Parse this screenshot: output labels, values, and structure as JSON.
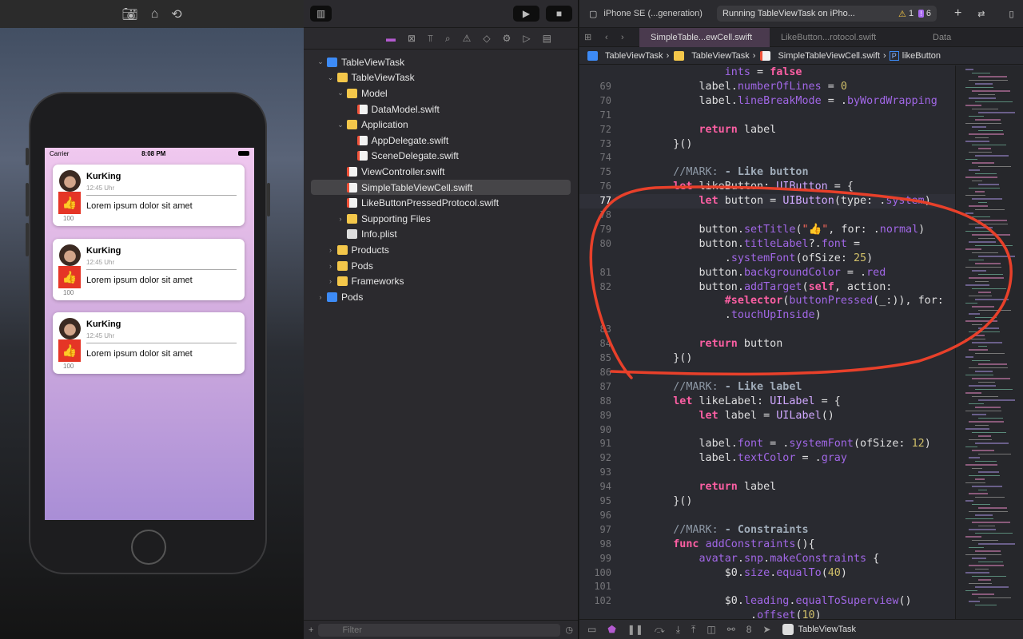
{
  "simulator": {
    "toolbar_icons": [
      "screenshot-icon",
      "home-icon",
      "rotate-icon"
    ],
    "status": {
      "carrier": "Carrier",
      "time": "8:08 PM"
    },
    "cards": [
      {
        "name": "KurKing",
        "time": "12:45 Uhr",
        "text": "Lorem ipsum dolor sit amet",
        "likes": "100",
        "like_emoji": "👍"
      },
      {
        "name": "KurKing",
        "time": "12:45 Uhr",
        "text": "Lorem ipsum dolor sit amet",
        "likes": "100",
        "like_emoji": "👍"
      },
      {
        "name": "KurKing",
        "time": "12:45 Uhr",
        "text": "Lorem ipsum dolor sit amet",
        "likes": "100",
        "like_emoji": "👍"
      }
    ]
  },
  "navigator": {
    "tree": [
      {
        "label": "TableViewTask",
        "depth": 0,
        "icon": "proj",
        "chev": "v"
      },
      {
        "label": "TableViewTask",
        "depth": 1,
        "icon": "folder",
        "chev": "v"
      },
      {
        "label": "Model",
        "depth": 2,
        "icon": "folder",
        "chev": "v"
      },
      {
        "label": "DataModel.swift",
        "depth": 3,
        "icon": "swift",
        "chev": ""
      },
      {
        "label": "Application",
        "depth": 2,
        "icon": "folder",
        "chev": "v"
      },
      {
        "label": "AppDelegate.swift",
        "depth": 3,
        "icon": "swift",
        "chev": ""
      },
      {
        "label": "SceneDelegate.swift",
        "depth": 3,
        "icon": "swift",
        "chev": ""
      },
      {
        "label": "ViewController.swift",
        "depth": 2,
        "icon": "swift",
        "chev": ""
      },
      {
        "label": "SimpleTableViewCell.swift",
        "depth": 2,
        "icon": "swift",
        "chev": "",
        "selected": true
      },
      {
        "label": "LikeButtonPressedProtocol.swift",
        "depth": 2,
        "icon": "swift",
        "chev": ""
      },
      {
        "label": "Supporting Files",
        "depth": 2,
        "icon": "folder",
        "chev": ">"
      },
      {
        "label": "Info.plist",
        "depth": 2,
        "icon": "plist",
        "chev": ""
      },
      {
        "label": "Products",
        "depth": 1,
        "icon": "folder",
        "chev": ">"
      },
      {
        "label": "Pods",
        "depth": 1,
        "icon": "folder",
        "chev": ">"
      },
      {
        "label": "Frameworks",
        "depth": 1,
        "icon": "folder",
        "chev": ">"
      },
      {
        "label": "Pods",
        "depth": 0,
        "icon": "proj",
        "chev": ">"
      }
    ],
    "filter_placeholder": "Filter"
  },
  "editor": {
    "device": "iPhone SE (...generation)",
    "run_status": "Running TableViewTask on iPho...",
    "warnings": "1",
    "issues": "6",
    "tabs": [
      "SimpleTable...ewCell.swift",
      "LikeButton...rotocol.swift",
      "Data"
    ],
    "breadcrumbs": [
      "TableViewTask",
      "TableViewTask",
      "SimpleTableViewCell.swift",
      "likeButton"
    ],
    "scheme": "TableViewTask",
    "accent_annotation_color": "#e8402a",
    "current_line": "77",
    "lines": [
      {
        "n": "",
        "t": [
          [
            "",
            "            "
          ],
          [
            "p",
            "ints"
          ],
          [
            "",
            " = "
          ],
          [
            "k",
            "false"
          ]
        ]
      },
      {
        "n": "69",
        "t": [
          [
            "",
            "        label."
          ],
          [
            "p",
            "numberOfLines"
          ],
          [
            "",
            " = "
          ],
          [
            "n",
            "0"
          ]
        ]
      },
      {
        "n": "70",
        "t": [
          [
            "",
            "        label."
          ],
          [
            "p",
            "lineBreakMode"
          ],
          [
            "",
            " = ."
          ],
          [
            "p",
            "byWordWrapping"
          ]
        ]
      },
      {
        "n": "71",
        "t": []
      },
      {
        "n": "72",
        "t": [
          [
            "",
            "        "
          ],
          [
            "k",
            "return"
          ],
          [
            "",
            " label"
          ]
        ]
      },
      {
        "n": "73",
        "t": [
          [
            "",
            "    }()"
          ]
        ]
      },
      {
        "n": "74",
        "t": []
      },
      {
        "n": "75",
        "t": [
          [
            "c",
            "    //MARK: "
          ],
          [
            "cb",
            "- Like button"
          ]
        ]
      },
      {
        "n": "76",
        "t": [
          [
            "k",
            "    let"
          ],
          [
            "",
            " likeButton: "
          ],
          [
            "t",
            "UIButton"
          ],
          [
            "",
            " = {"
          ]
        ]
      },
      {
        "n": "77",
        "t": [
          [
            "k",
            "        let"
          ],
          [
            "",
            " button = "
          ],
          [
            "t",
            "UIButton"
          ],
          [
            "",
            "(type: ."
          ],
          [
            "p",
            "system"
          ],
          [
            "",
            ")"
          ]
        ]
      },
      {
        "n": "78",
        "t": []
      },
      {
        "n": "79",
        "t": [
          [
            "",
            "        button."
          ],
          [
            "p",
            "setTitle"
          ],
          [
            "",
            "("
          ],
          [
            "s",
            "\"👍\""
          ],
          [
            "",
            ", for: ."
          ],
          [
            "p",
            "normal"
          ],
          [
            "",
            ")"
          ]
        ]
      },
      {
        "n": "80",
        "t": [
          [
            "",
            "        button."
          ],
          [
            "p",
            "titleLabel"
          ],
          [
            "",
            "?."
          ],
          [
            "p",
            "font"
          ],
          [
            "",
            " ="
          ]
        ]
      },
      {
        "n": "",
        "t": [
          [
            "",
            "            ."
          ],
          [
            "p",
            "systemFont"
          ],
          [
            "",
            "(ofSize: "
          ],
          [
            "n",
            "25"
          ],
          [
            "",
            ")"
          ]
        ]
      },
      {
        "n": "81",
        "t": [
          [
            "",
            "        button."
          ],
          [
            "p",
            "backgroundColor"
          ],
          [
            "",
            " = ."
          ],
          [
            "p",
            "red"
          ]
        ]
      },
      {
        "n": "82",
        "t": [
          [
            "",
            "        button."
          ],
          [
            "p",
            "addTarget"
          ],
          [
            "",
            "("
          ],
          [
            "k",
            "self"
          ],
          [
            "",
            ", action:"
          ]
        ]
      },
      {
        "n": "",
        "t": [
          [
            "k",
            "            #selector"
          ],
          [
            "",
            "("
          ],
          [
            "p",
            "buttonPressed"
          ],
          [
            "",
            "(_:)), for:"
          ]
        ]
      },
      {
        "n": "",
        "t": [
          [
            "",
            "            ."
          ],
          [
            "p",
            "touchUpInside"
          ],
          [
            "",
            ")"
          ]
        ]
      },
      {
        "n": "83",
        "t": []
      },
      {
        "n": "84",
        "t": [
          [
            "",
            "        "
          ],
          [
            "k",
            "return"
          ],
          [
            "",
            " button"
          ]
        ]
      },
      {
        "n": "85",
        "t": [
          [
            "",
            "    }()"
          ]
        ]
      },
      {
        "n": "86",
        "t": []
      },
      {
        "n": "87",
        "t": [
          [
            "c",
            "    //MARK: "
          ],
          [
            "cb",
            "- Like label"
          ]
        ]
      },
      {
        "n": "88",
        "t": [
          [
            "k",
            "    let"
          ],
          [
            "",
            " likeLabel: "
          ],
          [
            "t",
            "UILabel"
          ],
          [
            "",
            " = {"
          ]
        ]
      },
      {
        "n": "89",
        "t": [
          [
            "k",
            "        let"
          ],
          [
            "",
            " label = "
          ],
          [
            "t",
            "UILabel"
          ],
          [
            "",
            "()"
          ]
        ]
      },
      {
        "n": "90",
        "t": []
      },
      {
        "n": "91",
        "t": [
          [
            "",
            "        label."
          ],
          [
            "p",
            "font"
          ],
          [
            "",
            " = ."
          ],
          [
            "p",
            "systemFont"
          ],
          [
            "",
            "(ofSize: "
          ],
          [
            "n",
            "12"
          ],
          [
            "",
            ")"
          ]
        ]
      },
      {
        "n": "92",
        "t": [
          [
            "",
            "        label."
          ],
          [
            "p",
            "textColor"
          ],
          [
            "",
            " = ."
          ],
          [
            "p",
            "gray"
          ]
        ]
      },
      {
        "n": "93",
        "t": []
      },
      {
        "n": "94",
        "t": [
          [
            "",
            "        "
          ],
          [
            "k",
            "return"
          ],
          [
            "",
            " label"
          ]
        ]
      },
      {
        "n": "95",
        "t": [
          [
            "",
            "    }()"
          ]
        ]
      },
      {
        "n": "96",
        "t": []
      },
      {
        "n": "97",
        "t": [
          [
            "c",
            "    //MARK: "
          ],
          [
            "cb",
            "- Constraints"
          ]
        ]
      },
      {
        "n": "98",
        "t": [
          [
            "k",
            "    func"
          ],
          [
            "",
            " "
          ],
          [
            "p",
            "addConstraints"
          ],
          [
            "",
            "(){"
          ]
        ]
      },
      {
        "n": "99",
        "t": [
          [
            "",
            "        "
          ],
          [
            "p",
            "avatar"
          ],
          [
            "",
            "."
          ],
          [
            "p",
            "snp"
          ],
          [
            "",
            "."
          ],
          [
            "p",
            "makeConstraints"
          ],
          [
            "",
            " {"
          ]
        ]
      },
      {
        "n": "100",
        "t": [
          [
            "",
            "            $0."
          ],
          [
            "p",
            "size"
          ],
          [
            "",
            "."
          ],
          [
            "p",
            "equalTo"
          ],
          [
            "",
            "("
          ],
          [
            "n",
            "40"
          ],
          [
            "",
            ")"
          ]
        ]
      },
      {
        "n": "101",
        "t": []
      },
      {
        "n": "102",
        "t": [
          [
            "",
            "            $0."
          ],
          [
            "p",
            "leading"
          ],
          [
            "",
            "."
          ],
          [
            "p",
            "equalToSuperview"
          ],
          [
            "",
            "()"
          ]
        ]
      },
      {
        "n": "",
        "t": [
          [
            "",
            "                ."
          ],
          [
            "p",
            "offset"
          ],
          [
            "",
            "("
          ],
          [
            "n",
            "10"
          ],
          [
            "",
            ")"
          ]
        ]
      }
    ]
  }
}
